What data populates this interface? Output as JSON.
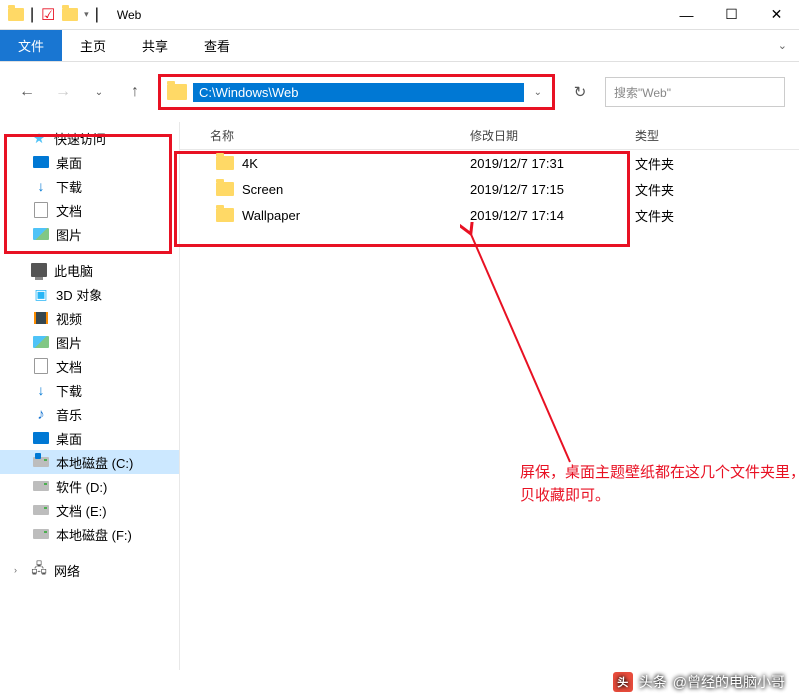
{
  "window": {
    "title": "Web",
    "qat_divider": "|"
  },
  "ribbon": {
    "file": "文件",
    "tabs": [
      "主页",
      "共享",
      "查看"
    ]
  },
  "nav": {
    "path": "C:\\Windows\\Web",
    "search_placeholder": "搜索\"Web\""
  },
  "columns": {
    "name": "名称",
    "date": "修改日期",
    "type": "类型"
  },
  "rows": [
    {
      "name": "4K",
      "date": "2019/12/7 17:31",
      "type": "文件夹"
    },
    {
      "name": "Screen",
      "date": "2019/12/7 17:15",
      "type": "文件夹"
    },
    {
      "name": "Wallpaper",
      "date": "2019/12/7 17:14",
      "type": "文件夹"
    }
  ],
  "sidebar": {
    "quick_access": "快速访问",
    "desktop": "桌面",
    "downloads": "下载",
    "documents": "文档",
    "pictures": "图片",
    "this_pc": "此电脑",
    "objects_3d": "3D 对象",
    "videos": "视频",
    "pictures2": "图片",
    "documents2": "文档",
    "downloads2": "下载",
    "music": "音乐",
    "desktop2": "桌面",
    "drive_c": "本地磁盘 (C:)",
    "drive_d": "软件 (D:)",
    "drive_e": "文档 (E:)",
    "drive_f": "本地磁盘 (F:)",
    "network": "网络"
  },
  "annotation": {
    "text": "屏保，桌面主题壁纸都在这几个文件夹里，拷贝收藏即可。"
  },
  "watermark": {
    "prefix": "头条",
    "author": "@曾经的电脑小哥"
  }
}
